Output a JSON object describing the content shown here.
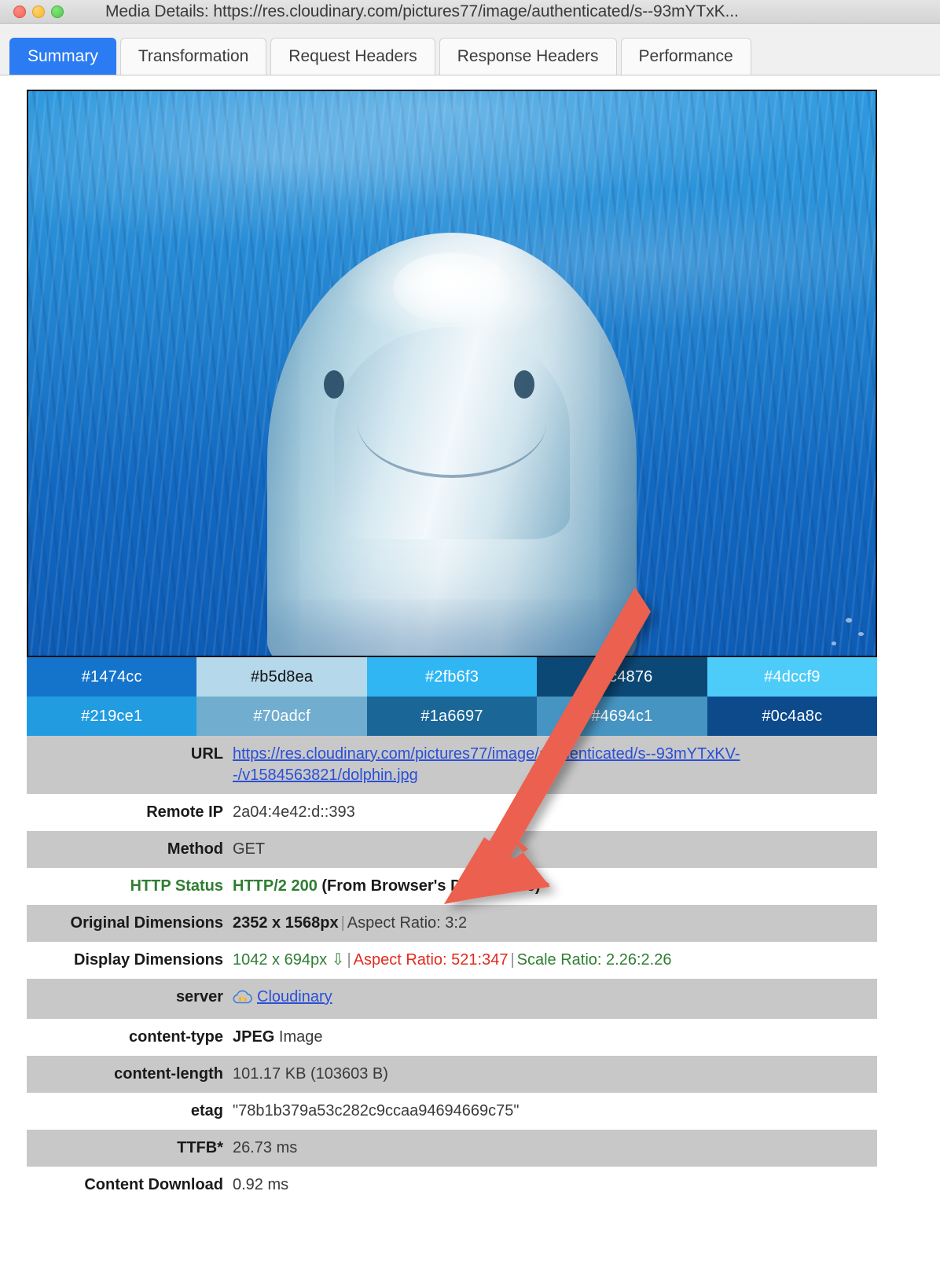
{
  "window": {
    "title": "Media Details: https://res.cloudinary.com/pictures77/image/authenticated/s--93mYTxK...",
    "controls": {
      "close": "close",
      "minimize": "minimize",
      "maximize": "maximize"
    }
  },
  "tabs": [
    {
      "label": "Summary",
      "active": true
    },
    {
      "label": "Transformation",
      "active": false
    },
    {
      "label": "Request Headers",
      "active": false
    },
    {
      "label": "Response Headers",
      "active": false
    },
    {
      "label": "Performance",
      "active": false
    }
  ],
  "preview": {
    "alt": "Underwater photo of a bottlenose dolphin facing the camera in blue water"
  },
  "palette": {
    "row1": [
      {
        "hex": "#1474cc",
        "label": "#1474cc",
        "text": "#ffffff"
      },
      {
        "hex": "#b5d8ea",
        "label": "#b5d8ea",
        "text": "#111111"
      },
      {
        "hex": "#2fb6f3",
        "label": "#2fb6f3",
        "text": "#ffffff"
      },
      {
        "hex": "#0c4876",
        "label": "#0c4876",
        "text": "#ffffff"
      },
      {
        "hex": "#4dccf9",
        "label": "#4dccf9",
        "text": "#ffffff"
      }
    ],
    "row2": [
      {
        "hex": "#219ce1",
        "label": "#219ce1",
        "text": "#ffffff"
      },
      {
        "hex": "#70adcf",
        "label": "#70adcf",
        "text": "#ffffff"
      },
      {
        "hex": "#1a6697",
        "label": "#1a6697",
        "text": "#ffffff"
      },
      {
        "hex": "#4694c1",
        "label": "#4694c1",
        "text": "#ffffff"
      },
      {
        "hex": "#0c4a8c",
        "label": "#0c4a8c",
        "text": "#ffffff"
      }
    ]
  },
  "details": [
    {
      "key": "URL",
      "type": "link",
      "value": "https://res.cloudinary.com/pictures77/image/authenticated/s--93mYTxKV--/v1584563821/dolphin.jpg"
    },
    {
      "key": "Remote IP",
      "type": "text",
      "value": "2a04:4e42:d::393"
    },
    {
      "key": "Method",
      "type": "text",
      "value": "GET"
    },
    {
      "key": "HTTP Status",
      "type": "status",
      "status_code": "HTTP/2 200",
      "status_note": "(From Browser's Disk Cache)"
    },
    {
      "key": "Original Dimensions",
      "type": "dimensions",
      "dimensions": "2352 x 1568px",
      "aspect_label": "Aspect Ratio: 3:2"
    },
    {
      "key": "Display Dimensions",
      "type": "display_dimensions",
      "dimensions": "1042 x 694px",
      "arrow_glyph": "⇩",
      "aspect_label": "Aspect Ratio: 521:347",
      "scale_label": "Scale Ratio: 2.26:2.26"
    },
    {
      "key": "server",
      "type": "server",
      "value": "Cloudinary"
    },
    {
      "key": "content-type",
      "type": "content_type",
      "format": "JPEG",
      "suffix": "Image"
    },
    {
      "key": "content-length",
      "type": "text",
      "value": "101.17 KB (103603 B)"
    },
    {
      "key": "etag",
      "type": "text",
      "value": "\"78b1b379a53c282c9ccaa94694669c75\""
    },
    {
      "key": "TTFB*",
      "type": "text",
      "value": "26.73 ms"
    },
    {
      "key": "Content Download",
      "type": "text",
      "value": "0.92 ms"
    }
  ],
  "annotation": {
    "arrow_color": "#ec6150",
    "description": "large red arrow pointing down-left toward the HTTP Status row"
  }
}
